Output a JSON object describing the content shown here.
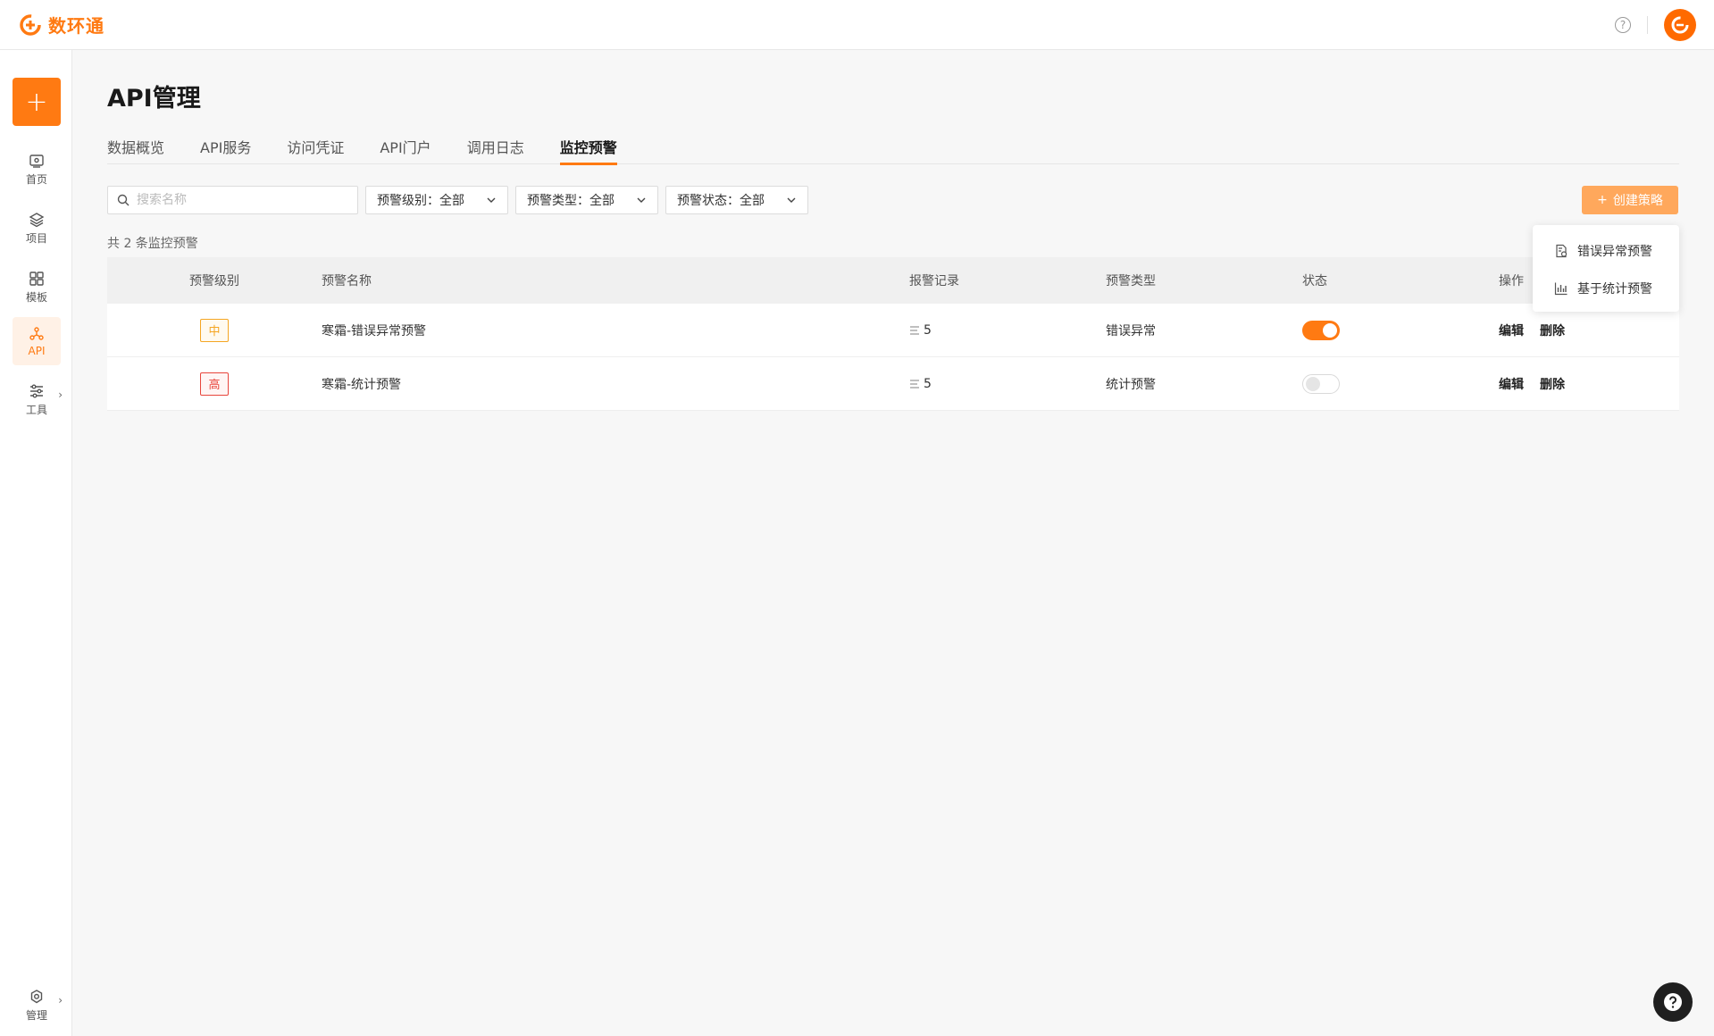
{
  "brand": {
    "name": "数环通",
    "accent": "#ff7a12"
  },
  "sidebar": {
    "items": [
      {
        "label": "首页",
        "icon": "home-icon"
      },
      {
        "label": "项目",
        "icon": "layers-icon"
      },
      {
        "label": "模板",
        "icon": "grid-icon"
      },
      {
        "label": "API",
        "icon": "api-icon",
        "active": true
      },
      {
        "label": "工具",
        "icon": "sliders-icon"
      },
      {
        "label": "管理",
        "icon": "gear-icon"
      }
    ]
  },
  "page": {
    "title": "API管理"
  },
  "tabs": [
    {
      "label": "数据概览"
    },
    {
      "label": "API服务"
    },
    {
      "label": "访问凭证"
    },
    {
      "label": "API门户"
    },
    {
      "label": "调用日志"
    },
    {
      "label": "监控预警",
      "active": true
    }
  ],
  "filters": {
    "search_placeholder": "搜索名称",
    "level": "预警级别：全部",
    "type": "预警类型：全部",
    "status": "预警状态：全部"
  },
  "toolbar": {
    "create_label": "创建策略"
  },
  "summary": {
    "count_text": "共 2 条监控预警"
  },
  "table": {
    "columns": [
      "预警级别",
      "预警名称",
      "报警记录",
      "预警类型",
      "状态",
      "操作"
    ],
    "rows": [
      {
        "level": "中",
        "level_color": "#f5a623",
        "name": "寒霜-错误异常预警",
        "records": "5",
        "type": "错误异常",
        "enabled": true,
        "edit": "编辑",
        "delete": "删除"
      },
      {
        "level": "高",
        "level_color": "#e8453c",
        "name": "寒霜-统计预警",
        "records": "5",
        "type": "统计预警",
        "enabled": false,
        "edit": "编辑",
        "delete": "删除"
      }
    ]
  },
  "dropdown": {
    "items": [
      {
        "label": "错误异常预警",
        "icon": "doc-clock-icon"
      },
      {
        "label": "基于统计预警",
        "icon": "bar-chart-icon"
      }
    ]
  }
}
